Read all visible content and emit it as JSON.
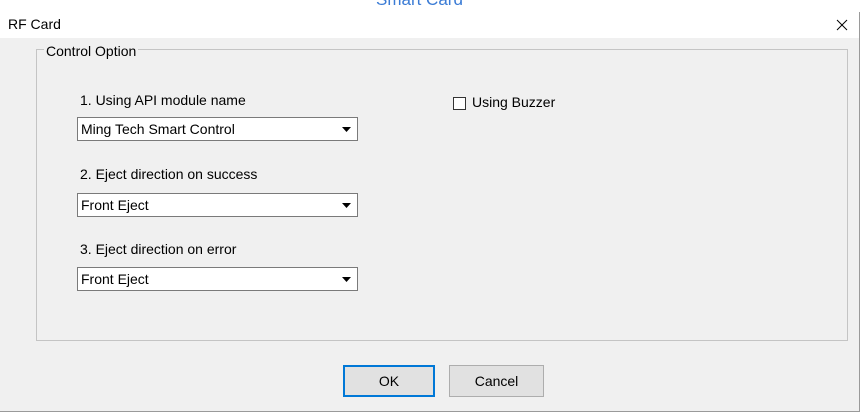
{
  "background_window": {
    "title_fragment": "Smart Card"
  },
  "dialog": {
    "title": "RF Card",
    "close_icon": "close-icon"
  },
  "control_option": {
    "legend": "Control Option",
    "api_module": {
      "label": "1. Using API module name",
      "value": "Ming Tech Smart Control"
    },
    "eject_success": {
      "label": "2. Eject direction on success",
      "value": "Front Eject"
    },
    "eject_error": {
      "label": "3. Eject direction on error",
      "value": "Front Eject"
    },
    "buzzer": {
      "label": "Using Buzzer",
      "checked": false
    }
  },
  "buttons": {
    "ok": "OK",
    "cancel": "Cancel"
  },
  "colors": {
    "window_bg": "#f0f0f0",
    "titlebar_bg": "#ffffff",
    "focus_border": "#0078d7",
    "background_title_text": "#3a7bd5"
  }
}
